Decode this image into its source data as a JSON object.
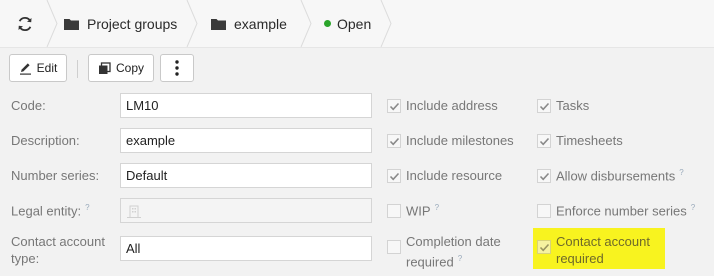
{
  "breadcrumb": {
    "items": [
      "Project groups",
      "example"
    ],
    "status": "Open",
    "status_color": "#2aa52a"
  },
  "toolbar": {
    "edit_label": "Edit",
    "copy_label": "Copy"
  },
  "form": {
    "code_label": "Code:",
    "code_value": "LM10",
    "description_label": "Description:",
    "description_value": "example",
    "number_series_label": "Number series:",
    "number_series_value": "Default",
    "legal_entity_label": "Legal entity:",
    "contact_account_type_label_1": "Contact account",
    "contact_account_type_label_2": "type:",
    "contact_account_type_value": "All",
    "help_mark": "?"
  },
  "checkboxes": {
    "include_address": {
      "label": "Include address",
      "checked": true
    },
    "include_milestones": {
      "label": "Include milestones",
      "checked": true
    },
    "include_resource": {
      "label": "Include resource",
      "checked": true
    },
    "wip": {
      "label": "WIP",
      "checked": false
    },
    "completion_date_required_1": "Completion date",
    "completion_date_required_2": "required",
    "tasks": {
      "label": "Tasks",
      "checked": true
    },
    "timesheets": {
      "label": "Timesheets",
      "checked": true
    },
    "allow_disbursements": {
      "label": "Allow disbursements",
      "checked": true
    },
    "enforce_number_series": {
      "label": "Enforce number series",
      "checked": false
    },
    "contact_account_required_1": "Contact account",
    "contact_account_required_2": "required"
  },
  "colors": {
    "highlight": "#f8f31f"
  }
}
